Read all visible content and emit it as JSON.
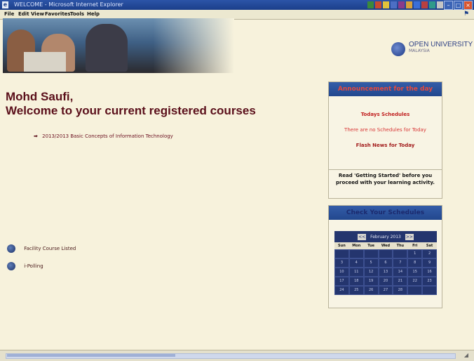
{
  "window": {
    "title": "WELCOME - Microsoft Internet Explorer",
    "app_icon": "ie-window-icon",
    "controls": {
      "minimize": "–",
      "maximize": "□",
      "close": "×"
    },
    "tray_colors": [
      "#3b8a3b",
      "#c84b2f",
      "#e0c23b",
      "#4c6fc4",
      "#8a3b8a",
      "#d8a03b",
      "#3b6fd8",
      "#b84040",
      "#2f9a8a",
      "#c4c4c4"
    ]
  },
  "menu": [
    "File",
    "Edit",
    "View",
    "Favorites",
    "Tools",
    "Help"
  ],
  "logo": {
    "line1": "OPEN UNIVERSITY",
    "line2": "MALAYSIA"
  },
  "welcome": {
    "name": "Mohd Saufi,",
    "message": "Welcome to your current registered courses"
  },
  "courses": [
    {
      "label": "2013/2013 Basic Concepts of Information Technology"
    }
  ],
  "side_links": [
    {
      "label": "Facility Course Listed",
      "icon": "globe-icon"
    },
    {
      "label": "i-Polling",
      "icon": "globe-icon"
    }
  ],
  "announcement": {
    "title": "Announcement for the day",
    "today_link": "Todays Schedules",
    "message": "There are no Schedules for Today",
    "flash_link": "Flash News for Today",
    "note": "Read 'Getting Started' before you proceed with your learning activity."
  },
  "schedule": {
    "title": "Check Your Schedules",
    "month": "February 2013",
    "prev": "<<",
    "next": ">>",
    "weekdays": [
      "Sun",
      "Mon",
      "Tue",
      "Wed",
      "Thu",
      "Fri",
      "Sat"
    ],
    "weeks": [
      [
        "",
        "",
        "",
        "",
        "",
        "1",
        "2"
      ],
      [
        "3",
        "4",
        "5",
        "6",
        "7",
        "8",
        "9"
      ],
      [
        "10",
        "11",
        "12",
        "13",
        "14",
        "15",
        "16"
      ],
      [
        "17",
        "18",
        "19",
        "20",
        "21",
        "22",
        "23"
      ],
      [
        "24",
        "25",
        "26",
        "27",
        "28",
        "",
        ""
      ]
    ]
  }
}
